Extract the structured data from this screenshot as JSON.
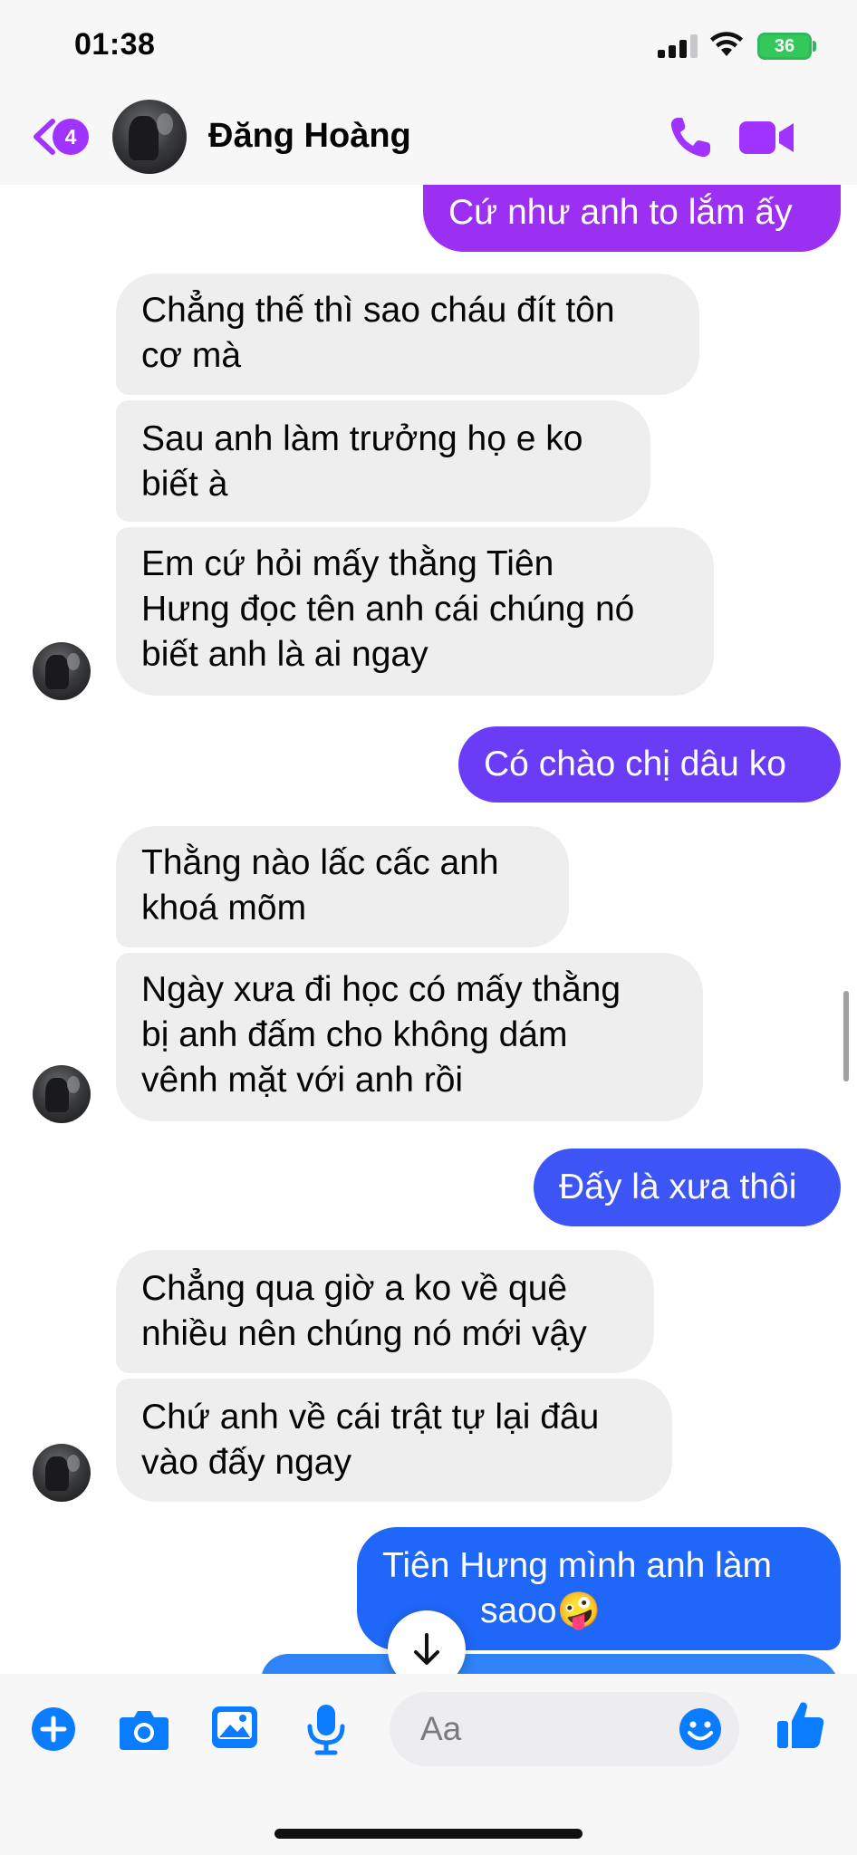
{
  "status": {
    "time": "01:38",
    "battery": "36"
  },
  "header": {
    "back_count": "4",
    "contact_name": "Đăng Hoàng",
    "icons": {
      "back": "chevron-left-icon",
      "call": "phone-icon",
      "video": "video-camera-icon"
    }
  },
  "messages": [
    {
      "side": "out",
      "text": "Cứ như anh to lắm ấy"
    },
    {
      "side": "in",
      "lines": [
        "Chẳng thế thì sao cháu đít tôn",
        "cơ mà"
      ]
    },
    {
      "side": "in",
      "lines": [
        "Sau anh làm trưởng họ e ko",
        "biết à"
      ]
    },
    {
      "side": "in",
      "lines": [
        "Em cứ hỏi mấy thằng Tiên",
        "Hưng đọc tên anh cái chúng nó",
        "biết anh là ai ngay"
      ]
    },
    {
      "side": "out",
      "text": "Có chào chị dâu ko"
    },
    {
      "side": "in",
      "lines": [
        "Thằng nào lấc cấc anh",
        "khoá mõm"
      ]
    },
    {
      "side": "in",
      "lines": [
        "Ngày xưa đi học có mấy thằng",
        "bị anh đấm cho không dám",
        "vênh mặt với anh rồi"
      ]
    },
    {
      "side": "out",
      "text": "Đấy là xưa thôi"
    },
    {
      "side": "in",
      "lines": [
        "Chẳng qua giờ a ko về quê",
        "nhiều nên chúng nó mới vậy"
      ]
    },
    {
      "side": "in",
      "lines": [
        "Chứ anh về cái trật tự lại đâu",
        "vào đấy ngay"
      ]
    },
    {
      "side": "out",
      "lines": [
        "Tiên Hưng mình anh làm",
        "saoo🤪"
      ]
    }
  ],
  "composer": {
    "placeholder": "Aa",
    "icons": [
      "plus-icon",
      "camera-icon",
      "image-icon",
      "microphone-icon",
      "emoji-icon",
      "thumbs-up-icon"
    ]
  },
  "colors": {
    "accent_purple": "#a033ff",
    "bubble_purple": "#9b2ff2",
    "bubble_violet": "#6a3cf6",
    "bubble_blue": "#1f67f8",
    "incoming": "#eeeeef",
    "icon_blue": "#0a7cff"
  }
}
